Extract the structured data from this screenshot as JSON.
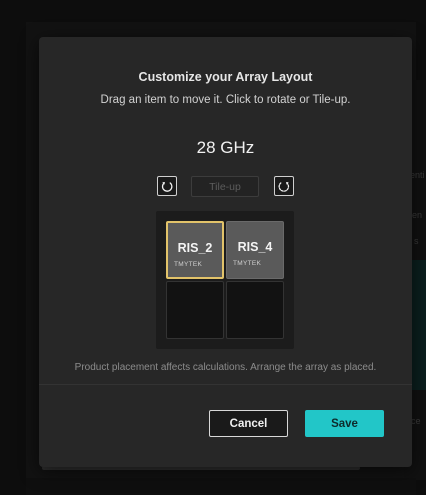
{
  "background": {
    "title_fragment": "",
    "right_fragments": [
      "enti",
      "en",
      "s",
      "ce"
    ]
  },
  "dialog": {
    "title": "Customize your Array Layout",
    "subtitle": "Drag an item to move it. Click to rotate or Tile-up.",
    "frequency": "28 GHz",
    "toolbar": {
      "rotate_left_icon": "rotate-counterclockwise-icon",
      "tileup_label": "Tile-up",
      "rotate_right_icon": "rotate-clockwise-icon"
    },
    "grid": {
      "tiles": [
        {
          "name": "RIS_2",
          "brand": "TMYTEK",
          "selected": true
        },
        {
          "name": "RIS_4",
          "brand": "TMYTEK",
          "selected": false
        }
      ]
    },
    "note": "Product placement affects calculations. Arrange the array as placed.",
    "buttons": {
      "cancel": "Cancel",
      "save": "Save"
    }
  },
  "colors": {
    "accent": "#22c6c8",
    "selection": "#e2c36a",
    "modal_bg": "#272727"
  }
}
